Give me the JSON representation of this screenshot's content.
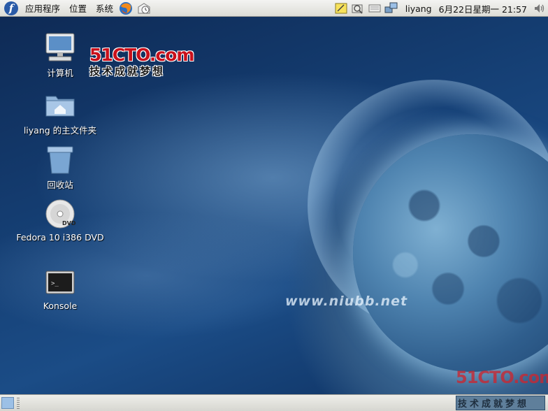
{
  "top_panel": {
    "menus": [
      "应用程序",
      "位置",
      "系统"
    ],
    "user": "liyang",
    "date": "6月22日星期一",
    "time": "21:57"
  },
  "desktop": {
    "icons": [
      {
        "label": "计算机",
        "icon": "computer-icon"
      },
      {
        "label": "liyang 的主文件夹",
        "icon": "home-folder-icon"
      },
      {
        "label": "回收站",
        "icon": "trash-icon"
      },
      {
        "label": "Fedora 10 i386 DVD",
        "icon": "dvd-icon"
      },
      {
        "label": "Konsole",
        "icon": "terminal-icon"
      }
    ],
    "brand_logo": "51CTO.com",
    "brand_tagline": "技术成就梦想",
    "watermark": "www.niubb.net",
    "corner_logo": "51CTO.com"
  },
  "bottom_panel": {
    "workspace_text": "技术成就梦想"
  },
  "colors": {
    "panel_bg": "#dcdcd6",
    "desktop_blue": "#1b4c86",
    "brand_red": "#c9101b"
  }
}
